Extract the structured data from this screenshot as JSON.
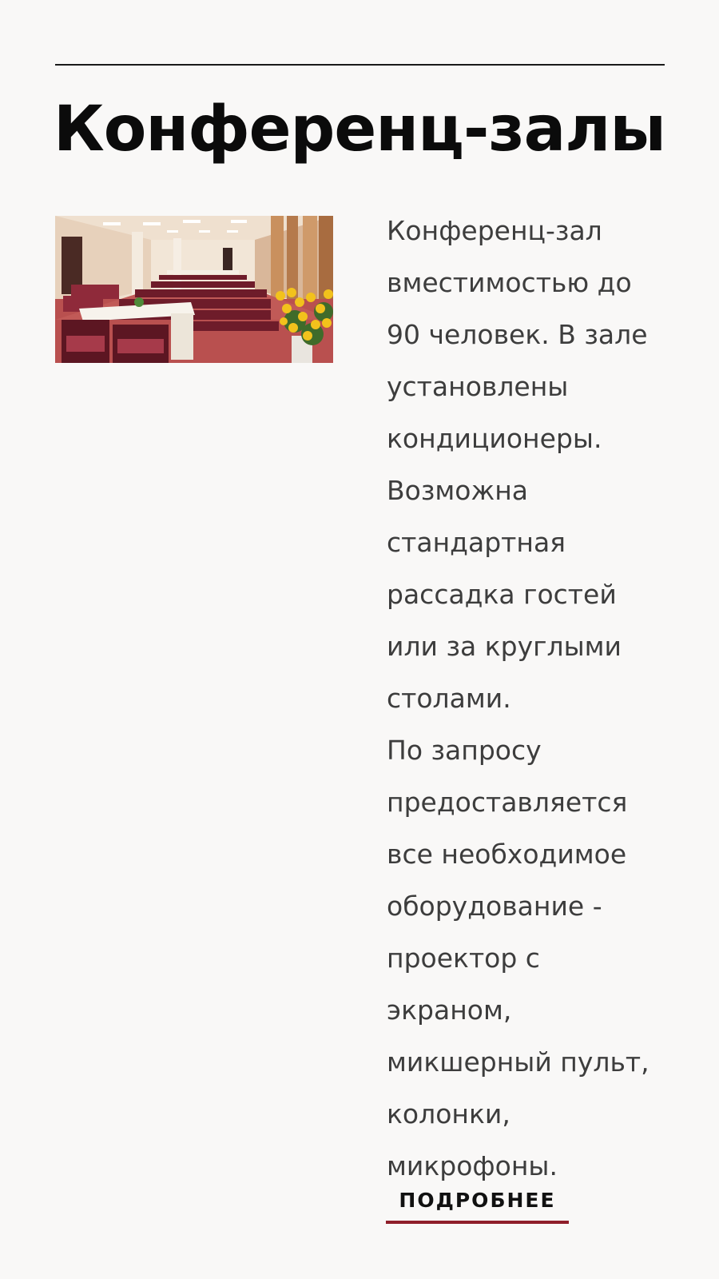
{
  "section": {
    "title": "Конференц-залы"
  },
  "photo": {
    "icon": "conference-room-photo",
    "colors": {
      "carpet": "#b9504f",
      "chairs": "#6e1c2a",
      "walls": "#efe0cf",
      "flowers": "#f2c21c"
    }
  },
  "description": {
    "paragraph1": [
      "Конференц-зал",
      "вместимостью до",
      "90 человек. В зале",
      "установлены",
      "кондиционеры.",
      "Возможна",
      "стандартная",
      "рассадка гостей",
      "или за круглыми",
      "столами."
    ],
    "paragraph2": [
      "По запросу",
      "предоставляется",
      "все необходимое",
      "оборудование -",
      "проектор с",
      "экраном,",
      "микшерный пульт,",
      "колонки,",
      "микрофоны."
    ]
  },
  "link": {
    "more_label": "ПОДРОБНЕЕ",
    "underline_color": "#8f1e2a"
  }
}
